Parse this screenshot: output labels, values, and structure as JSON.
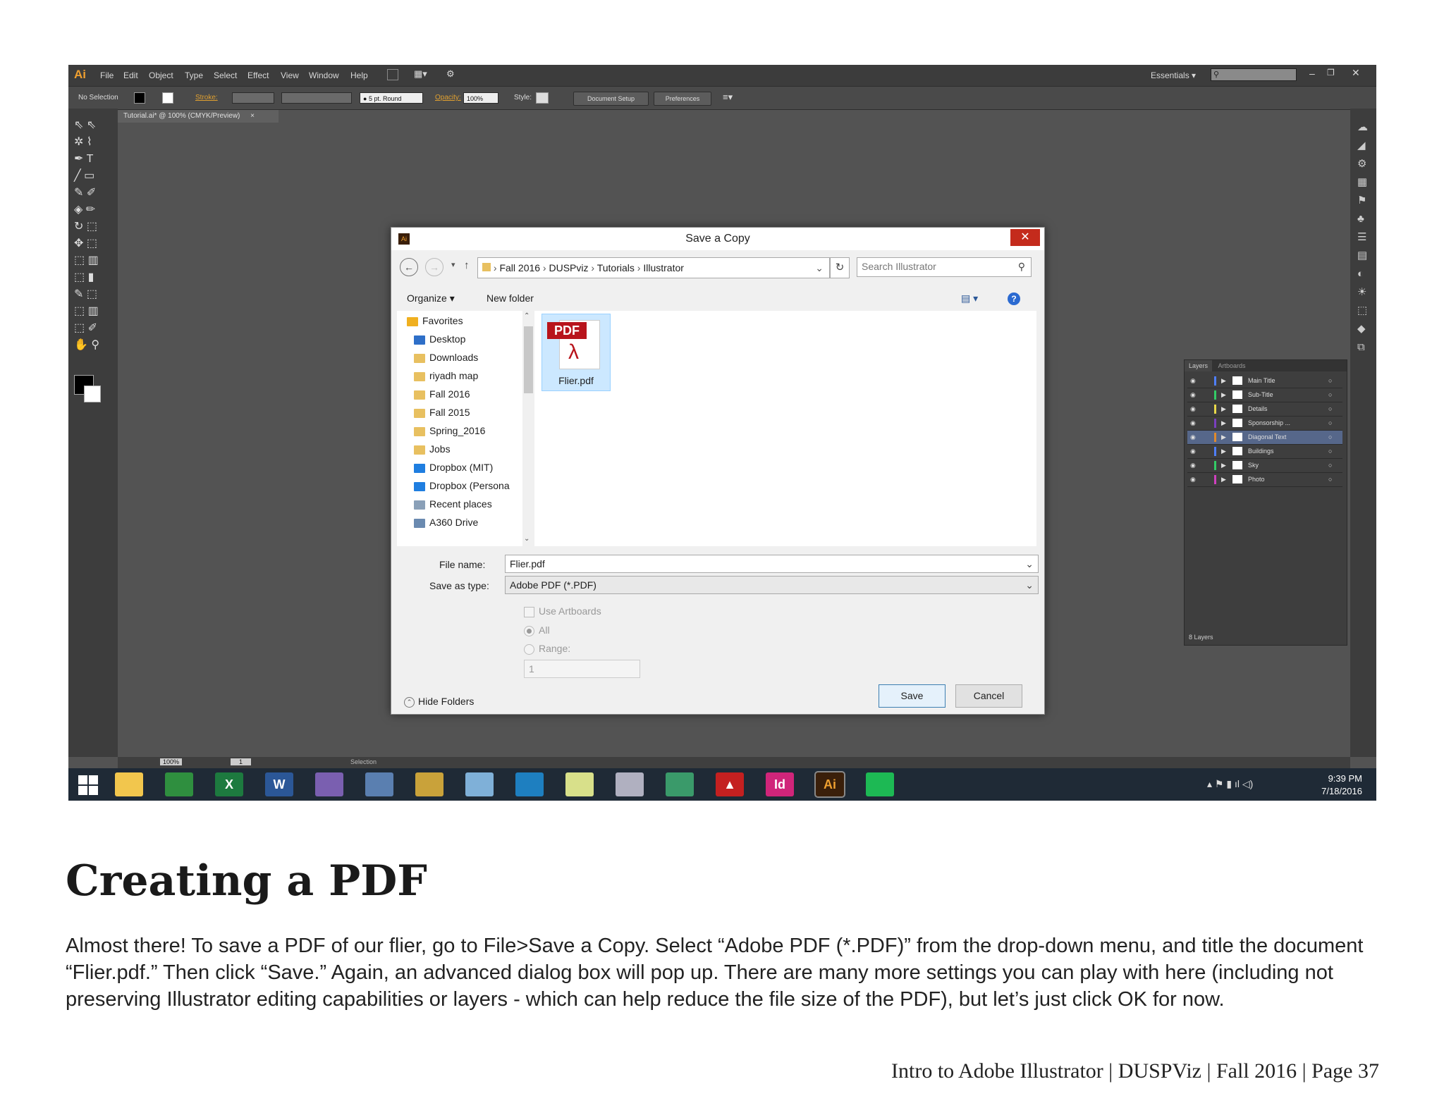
{
  "illustrator": {
    "logo": "Ai",
    "menu": [
      "File",
      "Edit",
      "Object",
      "Type",
      "Select",
      "Effect",
      "View",
      "Window",
      "Help"
    ],
    "workspace": "Essentials",
    "control_bar": {
      "selection": "No Selection",
      "stroke_label": "Stroke:",
      "brush": "5 pt. Round",
      "opacity_label": "Opacity:",
      "opacity_value": "100%",
      "style_label": "Style:",
      "document_setup": "Document Setup",
      "preferences": "Preferences"
    },
    "doc_tab": "Tutorial.ai* @ 100% (CMYK/Preview)",
    "status": {
      "zoom": "100%",
      "page": "1",
      "tool": "Selection"
    }
  },
  "layers_panel": {
    "tabs": [
      "Layers",
      "Artboards"
    ],
    "layers": [
      {
        "name": "Main Title",
        "color": "#4f7fff"
      },
      {
        "name": "Sub-Title",
        "color": "#33cc66"
      },
      {
        "name": "Details",
        "color": "#e8d84a"
      },
      {
        "name": "Sponsorship ...",
        "color": "#7a3fbf"
      },
      {
        "name": "Diagonal Text",
        "color": "#e08a2c"
      },
      {
        "name": "Buildings",
        "color": "#4f7fff"
      },
      {
        "name": "Sky",
        "color": "#33cc66"
      },
      {
        "name": "Photo",
        "color": "#d040c0"
      }
    ],
    "count": "8 Layers"
  },
  "dialog": {
    "title": "Save a Copy",
    "breadcrumb": [
      "Fall 2016",
      "DUSPviz",
      "Tutorials",
      "Illustrator"
    ],
    "search_placeholder": "Search Illustrator",
    "organize": "Organize",
    "new_folder": "New folder",
    "nav": [
      "Favorites",
      "Desktop",
      "Downloads",
      "riyadh map",
      "Fall 2016",
      "Fall 2015",
      "Spring_2016",
      "Jobs",
      "Dropbox (MIT)",
      "Dropbox (Persona",
      "Recent places",
      "A360 Drive"
    ],
    "file": {
      "name": "Flier.pdf",
      "badge": "PDF"
    },
    "file_name_label": "File name:",
    "file_name_value": "Flier.pdf",
    "save_type_label": "Save as type:",
    "save_type_value": "Adobe PDF (*.PDF)",
    "use_artboards": "Use Artboards",
    "all": "All",
    "range": "Range:",
    "range_value": "1",
    "hide_folders": "Hide Folders",
    "save": "Save",
    "cancel": "Cancel"
  },
  "taskbar": {
    "time": "9:39 PM",
    "date": "7/18/2016",
    "apps": [
      {
        "name": "file-explorer",
        "color": "#f2c64d",
        "glyph": ""
      },
      {
        "name": "chrome",
        "color": "#2f8f3f",
        "glyph": ""
      },
      {
        "name": "excel",
        "color": "#1d7a3f",
        "glyph": "X"
      },
      {
        "name": "word",
        "color": "#2b5797",
        "glyph": "W"
      },
      {
        "name": "app-diamond",
        "color": "#7a5fb0",
        "glyph": ""
      },
      {
        "name": "calculator",
        "color": "#5a7fb0",
        "glyph": ""
      },
      {
        "name": "app-box",
        "color": "#c9a23a",
        "glyph": ""
      },
      {
        "name": "app-note",
        "color": "#7fb0d8",
        "glyph": ""
      },
      {
        "name": "magnifier",
        "color": "#1e7fc0",
        "glyph": ""
      },
      {
        "name": "sticky-notes",
        "color": "#d8e08a",
        "glyph": ""
      },
      {
        "name": "paint",
        "color": "#b0b0c0",
        "glyph": ""
      },
      {
        "name": "app-globe",
        "color": "#3a9a6a",
        "glyph": ""
      },
      {
        "name": "acrobat",
        "color": "#c42020",
        "glyph": "▲"
      },
      {
        "name": "indesign",
        "color": "#d0257a",
        "glyph": "Id"
      },
      {
        "name": "illustrator",
        "color": "#3a1f0a",
        "glyph": "Ai"
      },
      {
        "name": "spotify",
        "color": "#1db954",
        "glyph": ""
      }
    ]
  },
  "caption": {
    "heading": "Creating a PDF",
    "paragraph": "Almost there! To save a PDF of our flier, go to File>Save a Copy. Select “Adobe PDF (*.PDF)” from the drop-down menu, and title the document “Flier.pdf.” Then click “Save.” Again, an advanced dialog box will pop up. There are many more settings you can play with here (including not preserving Illustrator editing capabilities or layers - which can help reduce the file size of the PDF), but let’s just click OK for now.",
    "footer": "Intro to Adobe Illustrator | DUSPViz | Fall 2016 | Page 37"
  }
}
